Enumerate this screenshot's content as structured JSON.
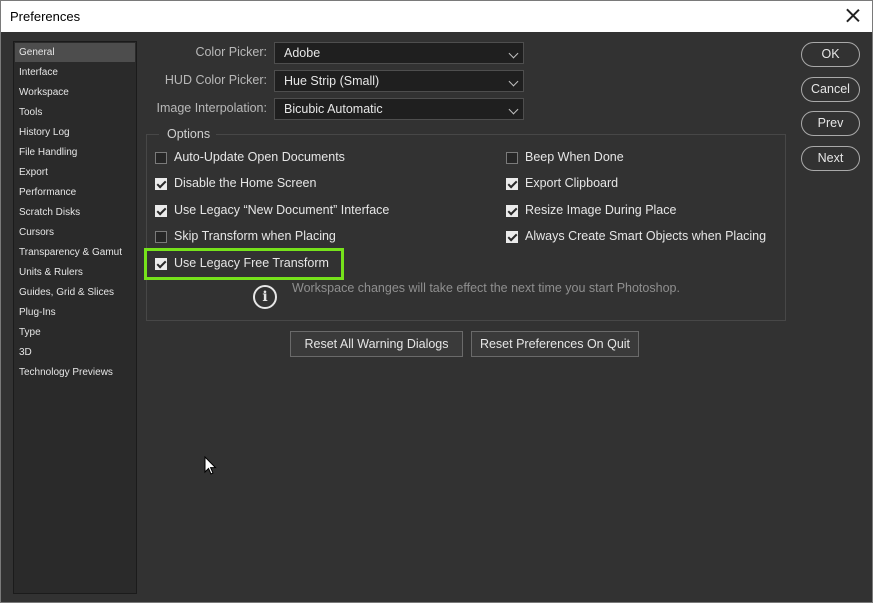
{
  "window": {
    "title": "Preferences"
  },
  "sidebar": {
    "items": [
      {
        "label": "General",
        "active": true
      },
      {
        "label": "Interface"
      },
      {
        "label": "Workspace"
      },
      {
        "label": "Tools"
      },
      {
        "label": "History Log"
      },
      {
        "label": "File Handling"
      },
      {
        "label": "Export"
      },
      {
        "label": "Performance"
      },
      {
        "label": "Scratch Disks"
      },
      {
        "label": "Cursors"
      },
      {
        "label": "Transparency & Gamut"
      },
      {
        "label": "Units & Rulers"
      },
      {
        "label": "Guides, Grid & Slices"
      },
      {
        "label": "Plug-Ins"
      },
      {
        "label": "Type"
      },
      {
        "label": "3D"
      },
      {
        "label": "Technology Previews"
      }
    ]
  },
  "settings": {
    "color_picker": {
      "label": "Color Picker:",
      "value": "Adobe"
    },
    "hud_color_picker": {
      "label": "HUD Color Picker:",
      "value": "Hue Strip (Small)"
    },
    "image_interpolation": {
      "label": "Image Interpolation:",
      "value": "Bicubic Automatic"
    }
  },
  "options": {
    "title": "Options",
    "left": [
      {
        "label": "Auto-Update Open Documents",
        "checked": false
      },
      {
        "label": "Disable the Home Screen",
        "checked": true
      },
      {
        "label": "Use Legacy “New Document” Interface",
        "checked": true
      },
      {
        "label": "Skip Transform when Placing",
        "checked": false
      },
      {
        "label": "Use Legacy Free Transform",
        "checked": true
      }
    ],
    "right": [
      {
        "label": "Beep When Done",
        "checked": false
      },
      {
        "label": "Export Clipboard",
        "checked": true
      },
      {
        "label": "Resize Image During Place",
        "checked": true
      },
      {
        "label": "Always Create Smart Objects when Placing",
        "checked": true
      }
    ],
    "info_text": "Workspace changes will take effect the next time you start Photoshop."
  },
  "buttons": {
    "reset_warnings": "Reset All Warning Dialogs",
    "reset_on_quit": "Reset Preferences On Quit",
    "ok": "OK",
    "cancel": "Cancel",
    "prev": "Prev",
    "next": "Next"
  },
  "colors": {
    "dialog_bg": "#323232",
    "highlight": "#76e21b"
  }
}
